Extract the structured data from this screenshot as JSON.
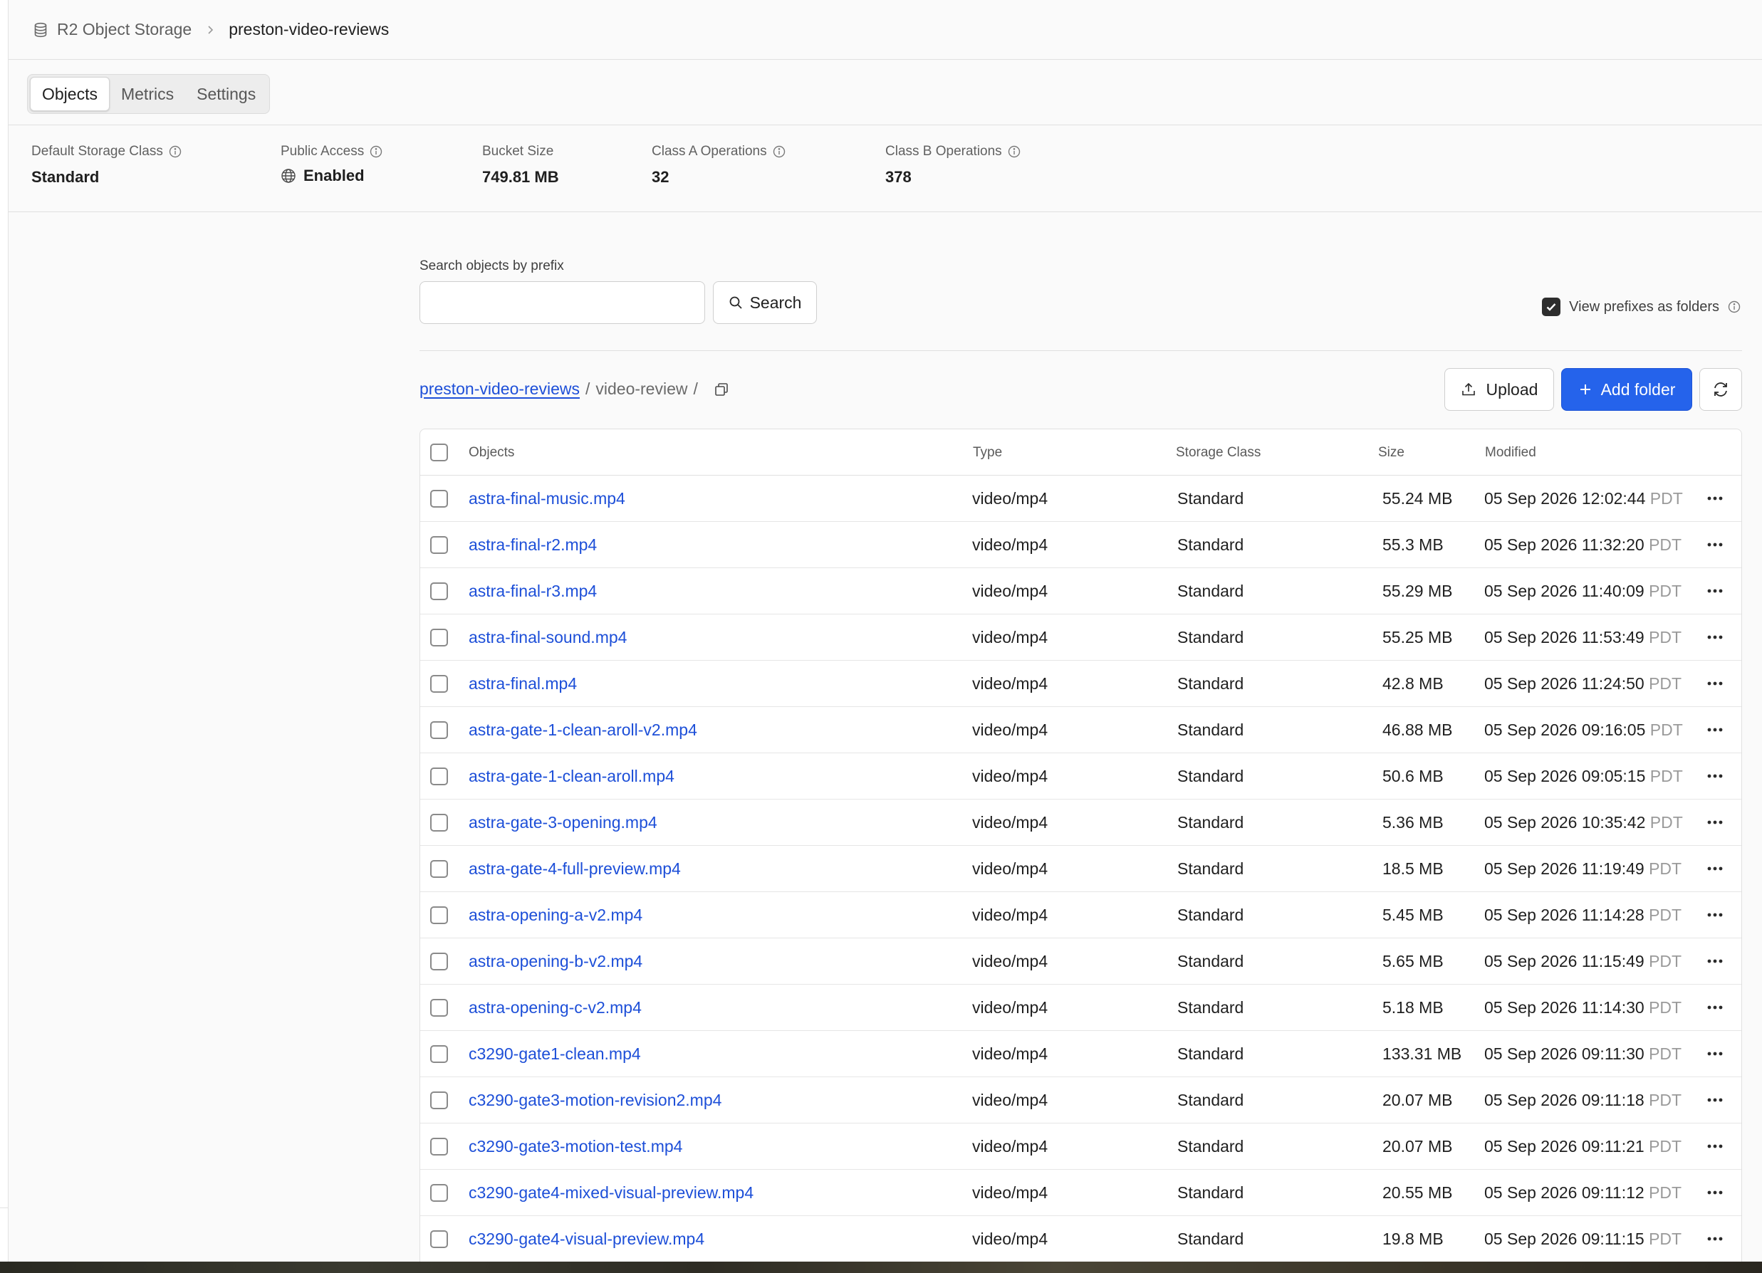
{
  "breadcrumb": {
    "root": "R2 Object Storage",
    "current": "preston-video-reviews"
  },
  "tabs": [
    {
      "label": "Objects",
      "active": true
    },
    {
      "label": "Metrics",
      "active": false
    },
    {
      "label": "Settings",
      "active": false
    }
  ],
  "stats": {
    "default_storage_class": {
      "label": "Default Storage Class",
      "value": "Standard"
    },
    "public_access": {
      "label": "Public Access",
      "value": "Enabled"
    },
    "bucket_size": {
      "label": "Bucket Size",
      "value": "749.81 MB"
    },
    "class_a": {
      "label": "Class A Operations",
      "value": "32"
    },
    "class_b": {
      "label": "Class B Operations",
      "value": "378"
    }
  },
  "search": {
    "label": "Search objects by prefix",
    "value": "",
    "button_label": "Search"
  },
  "view_prefixes": {
    "label": "View prefixes as folders",
    "checked": true
  },
  "path": {
    "bucket": "preston-video-reviews",
    "separator": "/",
    "folder": "video-review"
  },
  "actions": {
    "upload_label": "Upload",
    "add_folder_label": "Add folder"
  },
  "colors": {
    "accent": "#2563eb",
    "link": "#1d4fd8"
  },
  "table": {
    "headers": {
      "objects": "Objects",
      "type": "Type",
      "storage_class": "Storage Class",
      "size": "Size",
      "modified": "Modified"
    },
    "rows": [
      {
        "name": "astra-final-music.mp4",
        "type": "video/mp4",
        "storage_class": "Standard",
        "size": "55.24 MB",
        "modified": "05 Sep 2026 12:02:44",
        "tz": "PDT"
      },
      {
        "name": "astra-final-r2.mp4",
        "type": "video/mp4",
        "storage_class": "Standard",
        "size": "55.3 MB",
        "modified": "05 Sep 2026 11:32:20",
        "tz": "PDT"
      },
      {
        "name": "astra-final-r3.mp4",
        "type": "video/mp4",
        "storage_class": "Standard",
        "size": "55.29 MB",
        "modified": "05 Sep 2026 11:40:09",
        "tz": "PDT"
      },
      {
        "name": "astra-final-sound.mp4",
        "type": "video/mp4",
        "storage_class": "Standard",
        "size": "55.25 MB",
        "modified": "05 Sep 2026 11:53:49",
        "tz": "PDT"
      },
      {
        "name": "astra-final.mp4",
        "type": "video/mp4",
        "storage_class": "Standard",
        "size": "42.8 MB",
        "modified": "05 Sep 2026 11:24:50",
        "tz": "PDT"
      },
      {
        "name": "astra-gate-1-clean-aroll-v2.mp4",
        "type": "video/mp4",
        "storage_class": "Standard",
        "size": "46.88 MB",
        "modified": "05 Sep 2026 09:16:05",
        "tz": "PDT"
      },
      {
        "name": "astra-gate-1-clean-aroll.mp4",
        "type": "video/mp4",
        "storage_class": "Standard",
        "size": "50.6 MB",
        "modified": "05 Sep 2026 09:05:15",
        "tz": "PDT"
      },
      {
        "name": "astra-gate-3-opening.mp4",
        "type": "video/mp4",
        "storage_class": "Standard",
        "size": "5.36 MB",
        "modified": "05 Sep 2026 10:35:42",
        "tz": "PDT"
      },
      {
        "name": "astra-gate-4-full-preview.mp4",
        "type": "video/mp4",
        "storage_class": "Standard",
        "size": "18.5 MB",
        "modified": "05 Sep 2026 11:19:49",
        "tz": "PDT"
      },
      {
        "name": "astra-opening-a-v2.mp4",
        "type": "video/mp4",
        "storage_class": "Standard",
        "size": "5.45 MB",
        "modified": "05 Sep 2026 11:14:28",
        "tz": "PDT"
      },
      {
        "name": "astra-opening-b-v2.mp4",
        "type": "video/mp4",
        "storage_class": "Standard",
        "size": "5.65 MB",
        "modified": "05 Sep 2026 11:15:49",
        "tz": "PDT"
      },
      {
        "name": "astra-opening-c-v2.mp4",
        "type": "video/mp4",
        "storage_class": "Standard",
        "size": "5.18 MB",
        "modified": "05 Sep 2026 11:14:30",
        "tz": "PDT"
      },
      {
        "name": "c3290-gate1-clean.mp4",
        "type": "video/mp4",
        "storage_class": "Standard",
        "size": "133.31 MB",
        "modified": "05 Sep 2026 09:11:30",
        "tz": "PDT"
      },
      {
        "name": "c3290-gate3-motion-revision2.mp4",
        "type": "video/mp4",
        "storage_class": "Standard",
        "size": "20.07 MB",
        "modified": "05 Sep 2026 09:11:18",
        "tz": "PDT"
      },
      {
        "name": "c3290-gate3-motion-test.mp4",
        "type": "video/mp4",
        "storage_class": "Standard",
        "size": "20.07 MB",
        "modified": "05 Sep 2026 09:11:21",
        "tz": "PDT"
      },
      {
        "name": "c3290-gate4-mixed-visual-preview.mp4",
        "type": "video/mp4",
        "storage_class": "Standard",
        "size": "20.55 MB",
        "modified": "05 Sep 2026 09:11:12",
        "tz": "PDT"
      },
      {
        "name": "c3290-gate4-visual-preview.mp4",
        "type": "video/mp4",
        "storage_class": "Standard",
        "size": "19.8 MB",
        "modified": "05 Sep 2026 09:11:15",
        "tz": "PDT"
      }
    ]
  }
}
